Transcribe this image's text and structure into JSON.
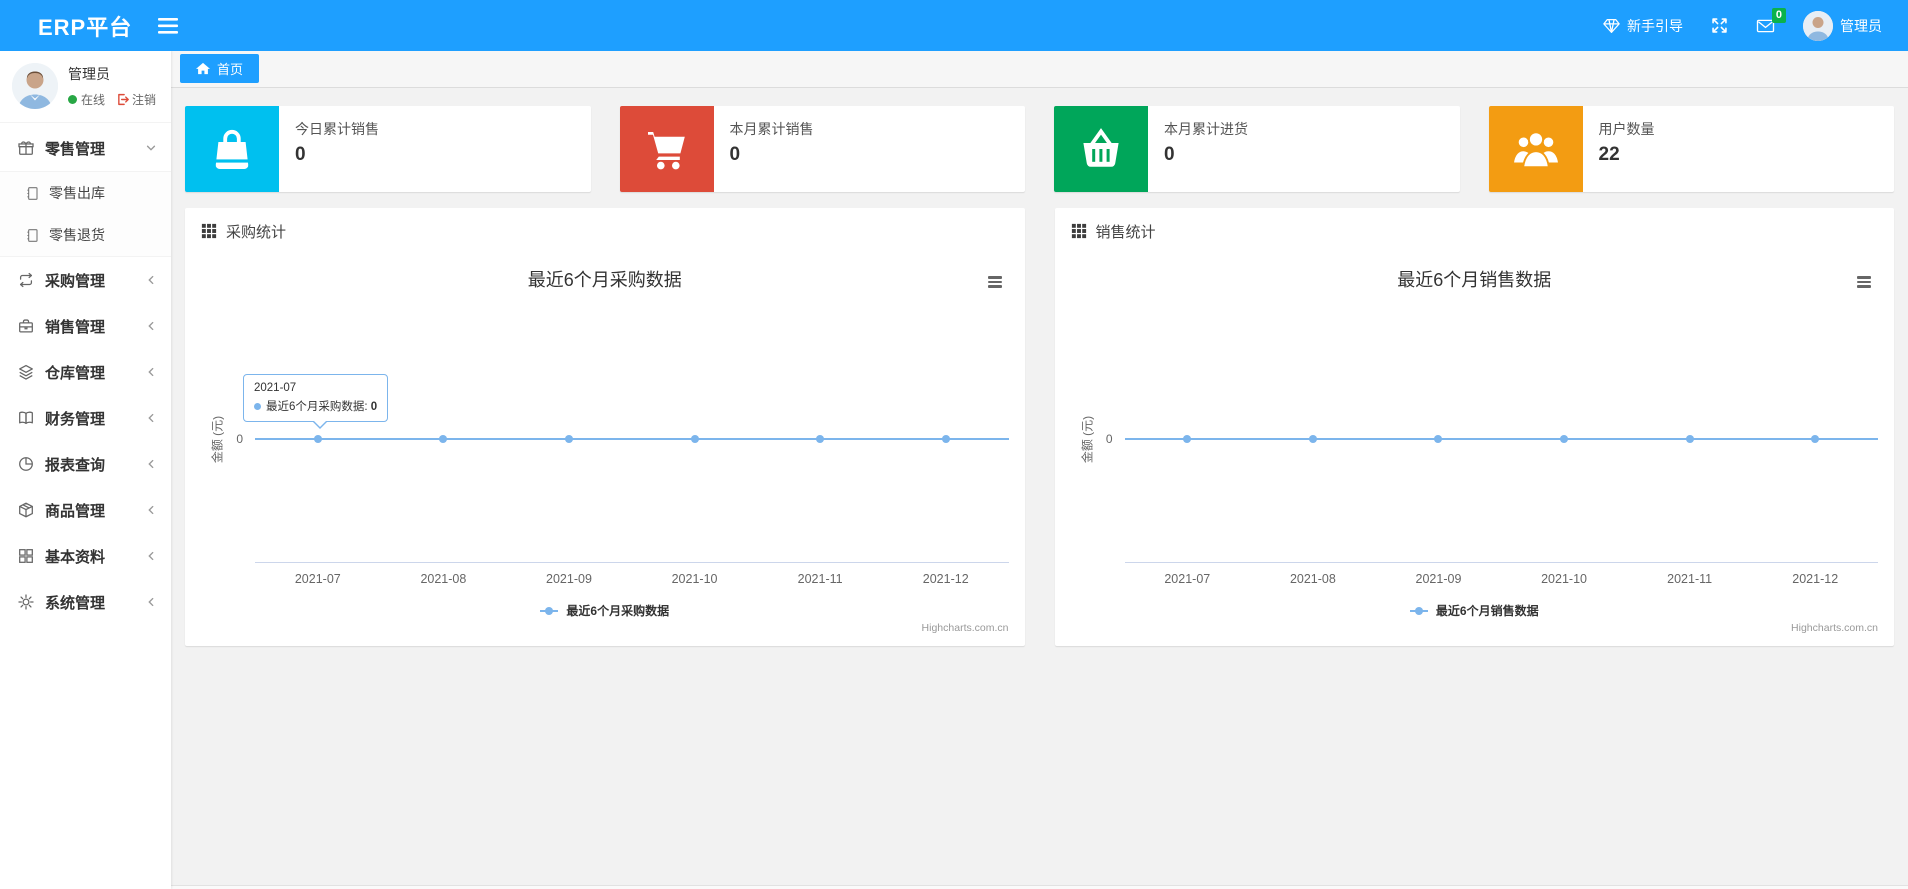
{
  "colors": {
    "header_blue": "#1E9FFF",
    "badge_green": "#0bb24c",
    "series_blue": "#7cb5ec"
  },
  "header": {
    "logo": "ERP平台",
    "guide": "新手引导",
    "mail_badge": "0",
    "username": "管理员"
  },
  "sidebar": {
    "profile": {
      "name": "管理员",
      "status_online": "在线",
      "logout": "注销"
    },
    "menu": [
      {
        "label": "零售管理",
        "icon": "gift-icon",
        "expanded": true,
        "children": [
          {
            "label": "零售出库",
            "icon": "file-icon"
          },
          {
            "label": "零售退货",
            "icon": "file-icon"
          }
        ]
      },
      {
        "label": "采购管理",
        "icon": "repeat-icon"
      },
      {
        "label": "销售管理",
        "icon": "briefcase-icon"
      },
      {
        "label": "仓库管理",
        "icon": "layers-icon"
      },
      {
        "label": "财务管理",
        "icon": "book-icon"
      },
      {
        "label": "报表查询",
        "icon": "pie-chart-icon"
      },
      {
        "label": "商品管理",
        "icon": "box-icon"
      },
      {
        "label": "基本资料",
        "icon": "th-large-icon"
      },
      {
        "label": "系统管理",
        "icon": "gear-icon"
      }
    ]
  },
  "tabs": [
    {
      "label": "首页",
      "icon": "home-icon",
      "active": true
    }
  ],
  "stat_cards": [
    {
      "title": "今日累计销售",
      "value": "0",
      "color": "#00c0ef",
      "icon": "shopping-bag-icon"
    },
    {
      "title": "本月累计销售",
      "value": "0",
      "color": "#dd4b39",
      "icon": "shopping-cart-icon"
    },
    {
      "title": "本月累计进货",
      "value": "0",
      "color": "#00a65a",
      "icon": "shopping-basket-icon"
    },
    {
      "title": "用户数量",
      "value": "22",
      "color": "#f39c12",
      "icon": "users-icon"
    }
  ],
  "panels": [
    {
      "title": "采购统计"
    },
    {
      "title": "销售统计"
    }
  ],
  "chart_data": [
    {
      "type": "line",
      "title": "最近6个月采购数据",
      "categories": [
        "2021-07",
        "2021-08",
        "2021-09",
        "2021-10",
        "2021-11",
        "2021-12"
      ],
      "series": [
        {
          "name": "最近6个月采购数据",
          "values": [
            0,
            0,
            0,
            0,
            0,
            0
          ]
        }
      ],
      "xlabel": "",
      "ylabel": "金额 (元)",
      "yticks": [
        "0"
      ],
      "color": "#7cb5ec",
      "legend_position": "bottom",
      "grid": "zero-line-only",
      "credits": "Highcharts.com.cn",
      "tooltip": {
        "header": "2021-07",
        "series": "最近6个月采购数据",
        "separator": ": ",
        "value": "0"
      }
    },
    {
      "type": "line",
      "title": "最近6个月销售数据",
      "categories": [
        "2021-07",
        "2021-08",
        "2021-09",
        "2021-10",
        "2021-11",
        "2021-12"
      ],
      "series": [
        {
          "name": "最近6个月销售数据",
          "values": [
            0,
            0,
            0,
            0,
            0,
            0
          ]
        }
      ],
      "xlabel": "",
      "ylabel": "金额 (元)",
      "yticks": [
        "0"
      ],
      "color": "#7cb5ec",
      "legend_position": "bottom",
      "grid": "zero-line-only",
      "credits": "Highcharts.com.cn",
      "tooltip": null
    }
  ]
}
